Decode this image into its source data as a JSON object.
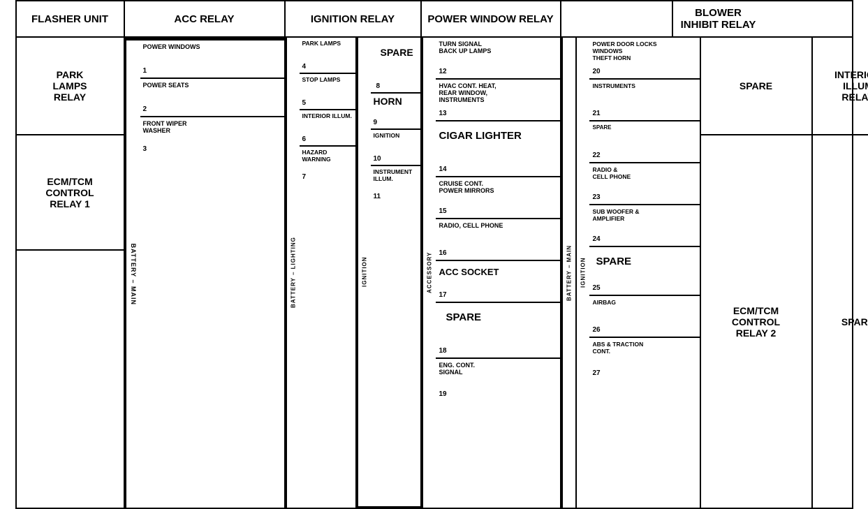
{
  "header": {
    "col1": "FLASHER UNIT",
    "col2": "ACC RELAY",
    "col3": "IGNITION RELAY",
    "col4": "POWER WINDOW RELAY",
    "col5": "BLOWER INHIBIT RELAY"
  },
  "left_col": {
    "cells": [
      {
        "label": "PARK\nLAMS\nRELAY",
        "text": "PARK\nLAMPS\nRELAY"
      },
      {
        "text": "ECM/TCM\nCONTROL\nRELAY 1"
      },
      {
        "text": ""
      }
    ]
  },
  "acc_top": "",
  "battery_main_label": "BATTERY – MAIN",
  "battery_main_items": [
    {
      "label": "POWER WINDOWS",
      "num": "1"
    },
    {
      "label": "POWER SEATS",
      "num": "2"
    },
    {
      "label": "FRONT WIPER\nWASHER",
      "num": "3"
    }
  ],
  "battery_lighting_label": "BATTERY – LIGHTING",
  "battery_lighting_items": [
    {
      "label": "PARK LAMPS",
      "num": "4"
    },
    {
      "label": "STOP LAMPS",
      "num": "5"
    },
    {
      "label": "INTERIOR ILLUM.",
      "num": "6"
    },
    {
      "label": "HAZARD WARNING",
      "num": "7"
    }
  ],
  "ignition_sub_label": "IGNITION",
  "ignition_sub_items": [
    {
      "label": "SPARE",
      "num": "8",
      "large": true
    },
    {
      "label": "HORN",
      "num": "9"
    },
    {
      "label": "IGNITION",
      "num": "10"
    },
    {
      "label": "INSTRUMENT ILLUM.",
      "num": "11"
    }
  ],
  "ignition_relay_items": [
    {
      "label": "TURN SIGNAL\nBACK UP LAMPS",
      "num": "12"
    },
    {
      "label": "HVAC CONT. HEAT,\nREAR WINDOW,\nINSTRUMENTS",
      "num": "13"
    },
    {
      "label": "CIGAR LIGHTER",
      "num": "14",
      "large": true
    },
    {
      "label": "CRUISE CONT.\nPOWER MIRRORS",
      "num": "15"
    },
    {
      "label": "RADIO, CELL PHONE",
      "num": "16"
    },
    {
      "label": "ACC SOCKET",
      "num": "17"
    },
    {
      "label": "SPARE",
      "num": "18",
      "large": true
    },
    {
      "label": "ENG. CONT.\nSIGNAL",
      "num": "19"
    }
  ],
  "accessory_label": "ACCESSORY",
  "battery_main2_label": "BATTERY – MAIN",
  "ignition2_label": "IGNITION",
  "power_window_items": [
    {
      "label": "POWER DOOR LOCKS\nWINDOWS\nTHEFT HORN",
      "num": "20"
    },
    {
      "label": "INSTRUMENTS",
      "num": "21"
    },
    {
      "label": "SPARE",
      "num": "22",
      "small": true
    },
    {
      "label": "RADIO &\nCELL PHONE",
      "num": "23"
    },
    {
      "label": "SUB WOOFER &\nAMPLIFIER",
      "num": "24"
    },
    {
      "label": "SPARE",
      "num": "25",
      "large": true
    },
    {
      "label": "AIRBAG",
      "num": "26"
    },
    {
      "label": "ABS & TRACTION\nCONT.",
      "num": "27"
    }
  ],
  "right_col": {
    "cells": [
      {
        "text": "SPARE"
      },
      {
        "text": "ECM/TCM\nCONTROL\nRELAY 2"
      }
    ]
  },
  "far_right_col": {
    "cells": [
      {
        "text": "INTERIOR\nILLUM\nRELAY"
      },
      {
        "text": "SPARE"
      }
    ]
  }
}
